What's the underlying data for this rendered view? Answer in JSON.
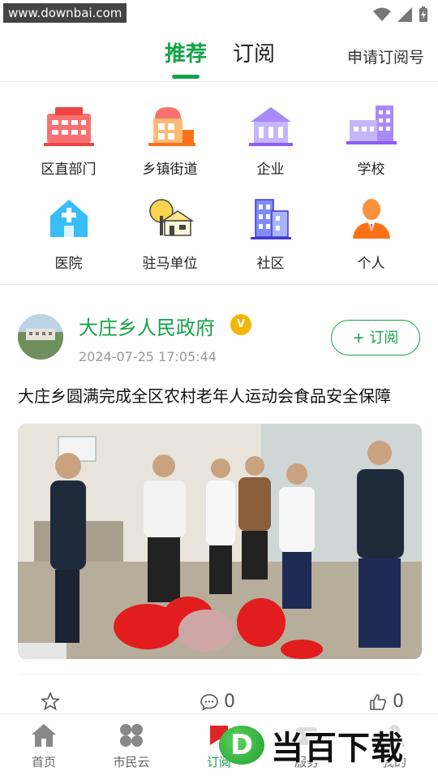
{
  "statusbar": {
    "watermark": "www.downbai.com"
  },
  "header": {
    "tabs": [
      {
        "label": "推荐"
      },
      {
        "label": "订阅"
      }
    ],
    "apply_label": "申请订阅号"
  },
  "categories": [
    {
      "label": "区直部门",
      "icon": "building-icon",
      "color": "#ef4444"
    },
    {
      "label": "乡镇街道",
      "icon": "town-icon",
      "color": "#f97316"
    },
    {
      "label": "企业",
      "icon": "enterprise-icon",
      "color": "#a78bfa"
    },
    {
      "label": "学校",
      "icon": "school-icon",
      "color": "#8b5cf6"
    },
    {
      "label": "医院",
      "icon": "hospital-icon",
      "color": "#38bdf8"
    },
    {
      "label": "驻马单位",
      "icon": "unit-icon",
      "color": "#f59e0b"
    },
    {
      "label": "社区",
      "icon": "community-icon",
      "color": "#6366f1"
    },
    {
      "label": "个人",
      "icon": "person-icon",
      "color": "#f97316"
    }
  ],
  "post": {
    "org_name": "大庄乡人民政府",
    "badge": "V",
    "time": "2024-07-25 17:05:44",
    "subscribe_label": "+ 订阅",
    "title": "大庄乡圆满完成全区农村老年人运动会食品安全保障",
    "comments": "0",
    "likes": "0"
  },
  "bottom_nav": [
    {
      "label": "首页",
      "icon": "home-icon"
    },
    {
      "label": "市民云",
      "icon": "clover-icon"
    },
    {
      "label": "订阅",
      "icon": "subscribe-icon",
      "active": true
    },
    {
      "label": "服务",
      "icon": "service-icon"
    },
    {
      "label": "我的",
      "icon": "profile-icon"
    }
  ],
  "brand_watermark": {
    "logo": "D",
    "text": "当百下载"
  },
  "colors": {
    "accent": "#16a34a",
    "badge": "#f2b705"
  }
}
